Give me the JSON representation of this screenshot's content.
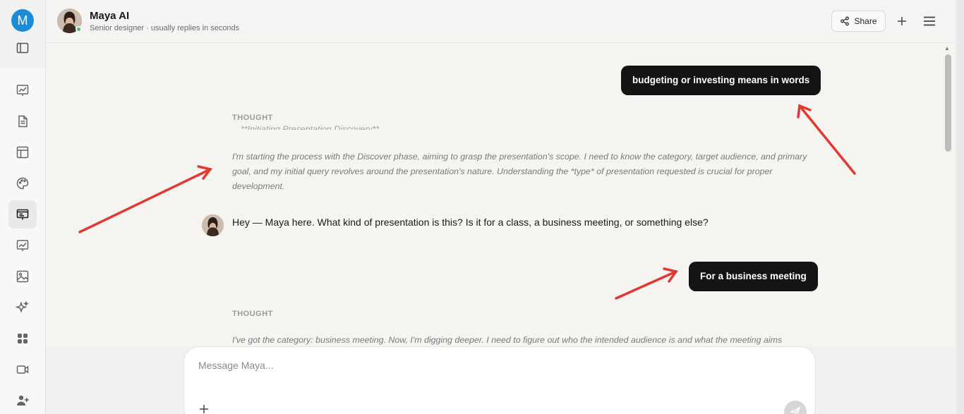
{
  "sidebar": {
    "user_initial": "M",
    "icons": [
      "sidebar-toggle-icon",
      "chart-icon",
      "document-icon",
      "layout-icon",
      "palette-icon",
      "presentation-icon",
      "trending-icon",
      "image-icon",
      "sparkles-icon",
      "apps-icon",
      "video-icon",
      "add-user-icon"
    ]
  },
  "header": {
    "title": "Maya AI",
    "subtitle": "Senior designer · usually replies in seconds",
    "share_label": "Share"
  },
  "chat": {
    "user_message_1": "budgeting or investing means in words",
    "thought_label_1": "THOUGHT",
    "thought_heading_cut": "**Initiating Presentation Discovery**",
    "thought_text_1": "I'm starting the process with the Discover phase, aiming to grasp the presentation's scope. I need to know the category, target audience, and primary goal, and my initial query revolves around the presentation's nature. Understanding the *type* of presentation requested is crucial for proper development.",
    "bot_message_1": "Hey — Maya here. What kind of presentation is this? Is it for a class, a business meeting, or something else?",
    "user_message_2": "For a business meeting",
    "thought_label_2": "THOUGHT",
    "thought_text_2": "I've got the category: business meeting. Now, I'm digging deeper. I need to figure out who the intended audience is and what the meeting aims"
  },
  "composer": {
    "placeholder": "Message Maya..."
  },
  "colors": {
    "accent_avatar": "#1a8cd8",
    "bubble_bg": "#141414",
    "annotation_arrow": "#e03a33",
    "online_dot": "#3ec46d"
  }
}
